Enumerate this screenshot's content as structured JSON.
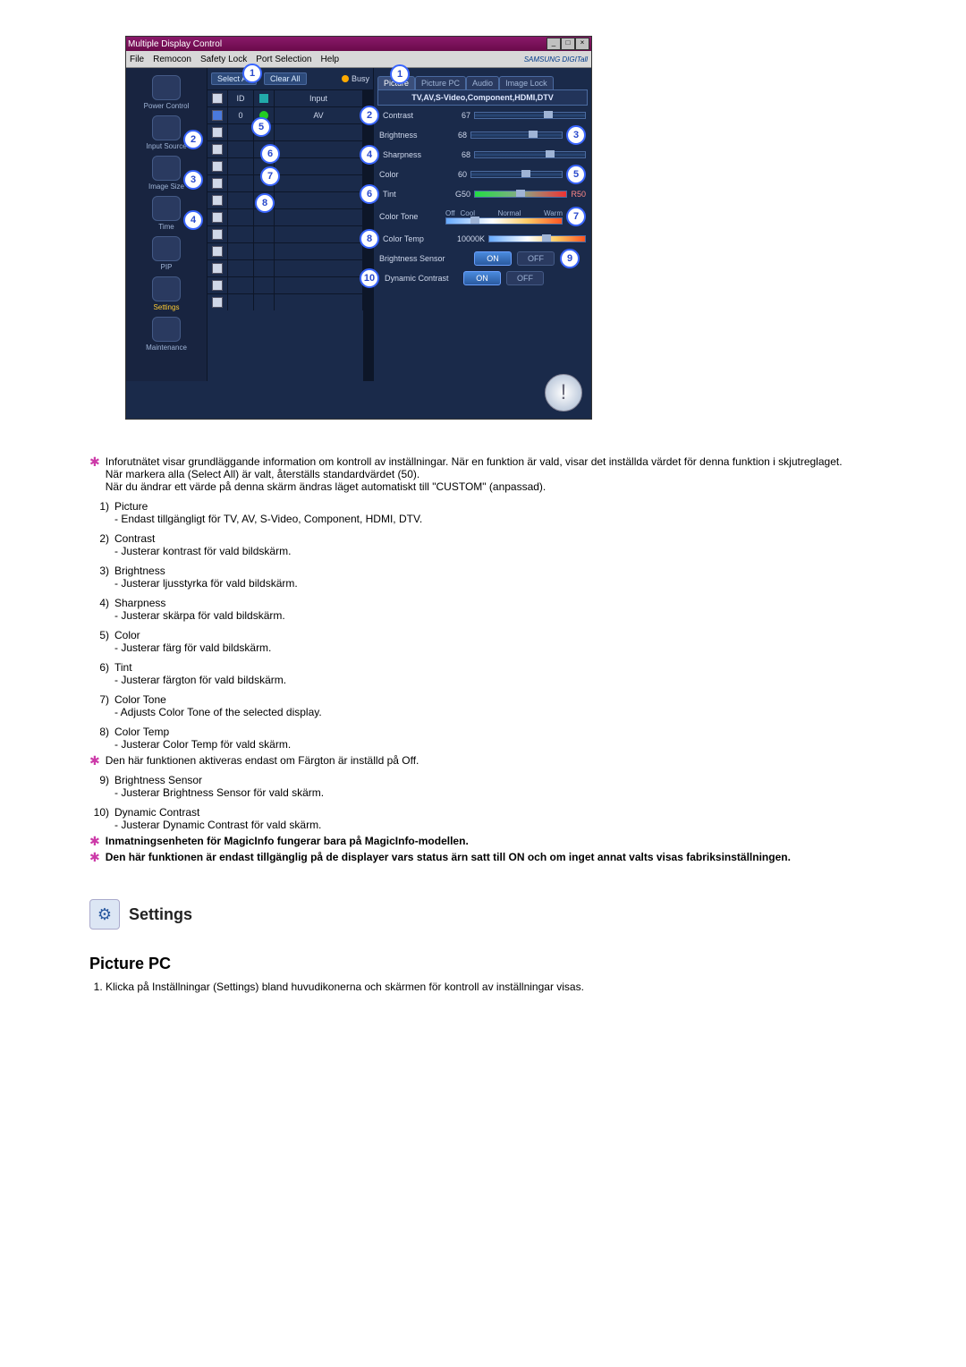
{
  "window": {
    "title": "Multiple Display Control",
    "menu": [
      "File",
      "Remocon",
      "Safety Lock",
      "Port Selection",
      "Help"
    ],
    "brand": "SAMSUNG DIGITall"
  },
  "sidebar": {
    "items": [
      {
        "label": "Power Control"
      },
      {
        "label": "Input Source"
      },
      {
        "label": "Image Size"
      },
      {
        "label": "Time"
      },
      {
        "label": "PIP"
      },
      {
        "label": "Settings"
      },
      {
        "label": "Maintenance"
      }
    ]
  },
  "toolbar": {
    "select_all": "Select All",
    "clear_all": "Clear All",
    "busy": "Busy"
  },
  "grid": {
    "headers": {
      "id": "ID",
      "input": "Input"
    },
    "first_row": {
      "id": "0",
      "input": "AV"
    }
  },
  "tabs": {
    "items": [
      "Picture",
      "Picture PC",
      "Audio",
      "Image Lock"
    ],
    "subtitle": "TV,AV,S-Video,Component,HDMI,DTV"
  },
  "sliders": {
    "contrast": {
      "label": "Contrast",
      "value": "67"
    },
    "brightness": {
      "label": "Brightness",
      "value": "68"
    },
    "sharpness": {
      "label": "Sharpness",
      "value": "68"
    },
    "color": {
      "label": "Color",
      "value": "60"
    },
    "tint": {
      "label": "Tint",
      "left": "G50",
      "right": "R50"
    },
    "color_tone": {
      "label": "Color Tone",
      "opts": [
        "Off",
        "Cool",
        "Normal",
        "Warm"
      ]
    },
    "color_temp": {
      "label": "Color Temp",
      "value": "10000K"
    }
  },
  "buttons": {
    "brightness_sensor": {
      "label": "Brightness Sensor",
      "on": "ON",
      "off": "OFF"
    },
    "dynamic_contrast": {
      "label": "Dynamic Contrast",
      "on": "ON",
      "off": "OFF"
    }
  },
  "callouts": [
    "1",
    "2",
    "3",
    "4",
    "5",
    "6",
    "7",
    "8",
    "9",
    "10",
    "2",
    "3",
    "4",
    "5",
    "6",
    "7",
    "8"
  ],
  "notes": {
    "star1a": "Inforutnätet visar grundläggande information om kontroll av inställningar. När en funktion är vald, visar det inställda värdet för denna funktion i skjutreglaget.",
    "star1b": "När markera alla (Select All) är valt, återställs standardvärdet (50).",
    "star1c": "När du ändrar ett värde på denna skärm ändras läget automatiskt till \"CUSTOM\" (anpassad).",
    "items": [
      {
        "n": "1)",
        "t": "Picture",
        "d": "- Endast tillgängligt för TV, AV, S-Video, Component, HDMI, DTV."
      },
      {
        "n": "2)",
        "t": "Contrast",
        "d": "- Justerar kontrast för vald bildskärm."
      },
      {
        "n": "3)",
        "t": "Brightness",
        "d": "- Justerar ljusstyrka för vald bildskärm."
      },
      {
        "n": "4)",
        "t": "Sharpness",
        "d": "- Justerar skärpa för vald bildskärm."
      },
      {
        "n": "5)",
        "t": "Color",
        "d": "- Justerar färg för vald bildskärm."
      },
      {
        "n": "6)",
        "t": "Tint",
        "d": "- Justerar färgton för vald bildskärm."
      },
      {
        "n": "7)",
        "t": "Color Tone",
        "d": "- Adjusts Color Tone of the selected display."
      },
      {
        "n": "8)",
        "t": "Color Temp",
        "d": "- Justerar Color Temp för vald skärm."
      }
    ],
    "star2": "Den här funktionen aktiveras endast om Färgton är inställd på Off.",
    "items2": [
      {
        "n": "9)",
        "t": "Brightness Sensor",
        "d": "- Justerar Brightness Sensor för vald skärm."
      },
      {
        "n": "10)",
        "t": "Dynamic Contrast",
        "d": "- Justerar Dynamic Contrast för vald skärm."
      }
    ],
    "star3": "Inmatningsenheten för MagicInfo fungerar bara på MagicInfo-modellen.",
    "star4": "Den här funktionen är endast tillgänglig på de displayer vars status ärn satt till ON och om inget annat valts visas fabriksinställningen."
  },
  "section": {
    "title": "Settings",
    "subtitle": "Picture PC",
    "step1": "Klicka på Inställningar (Settings) bland huvudikonerna och skärmen för kontroll av inställningar visas."
  }
}
